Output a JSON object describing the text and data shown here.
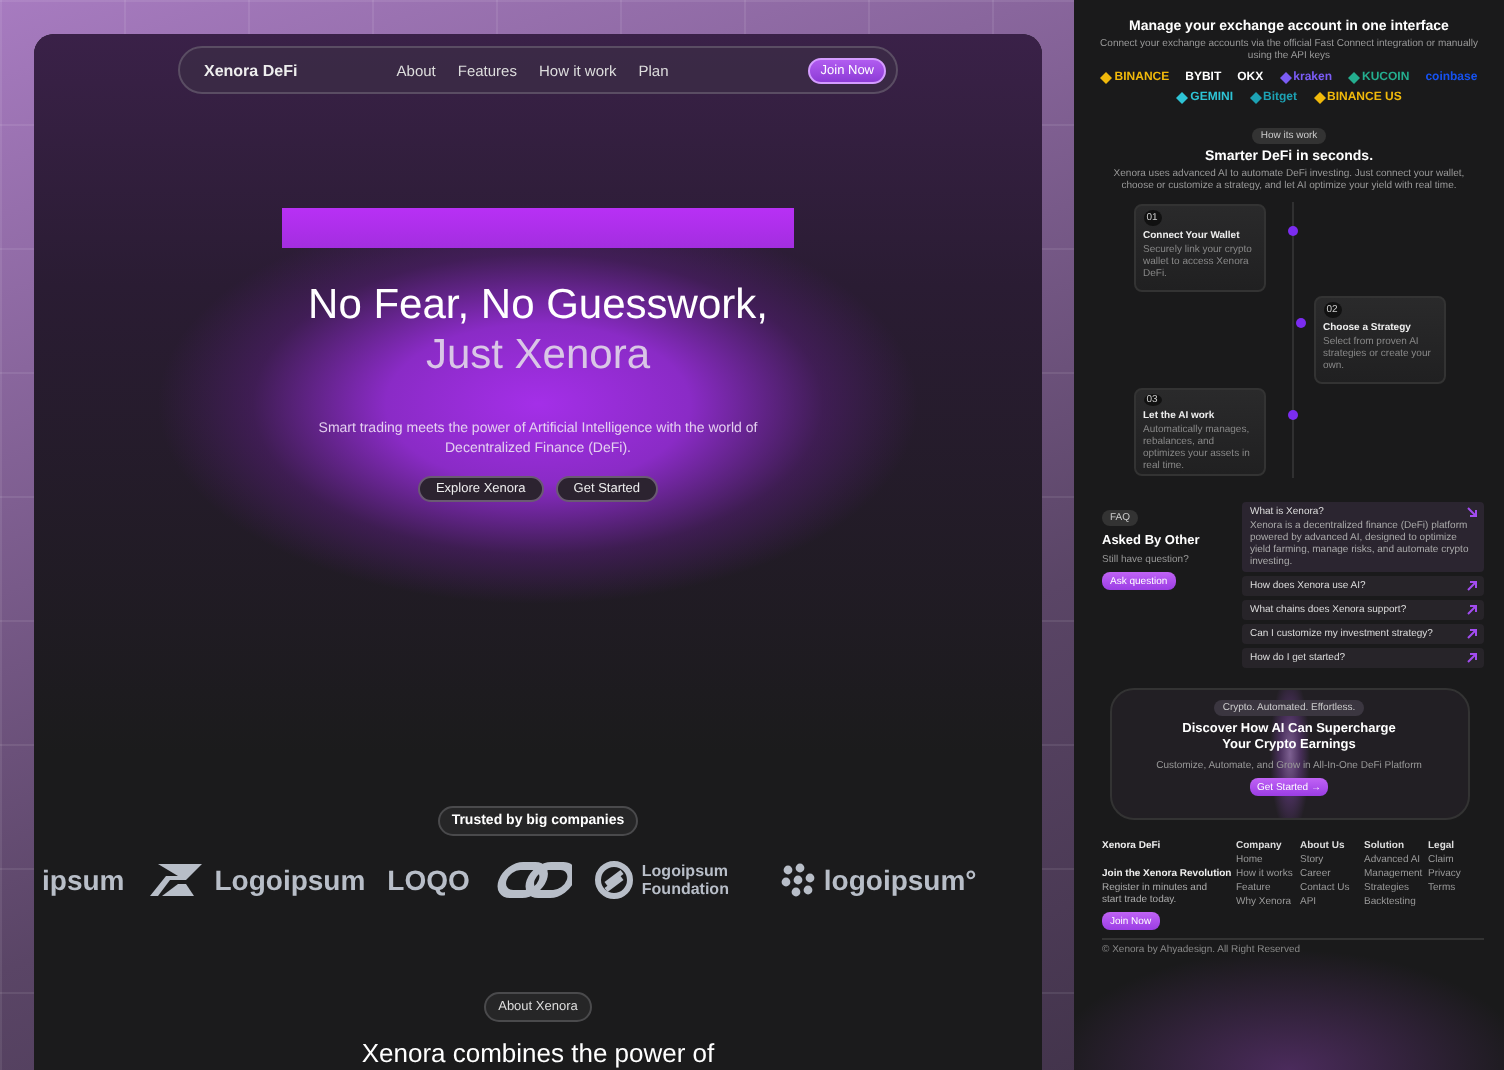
{
  "landing": {
    "nav": {
      "brand": "Xenora DeFi",
      "links": [
        "About",
        "Features",
        "How it work",
        "Plan"
      ],
      "cta": "Join Now"
    },
    "hero": {
      "title_line_1": "No Fear, No Guesswork,",
      "title_line_2": "Just Xenora",
      "subtitle": "Smart trading meets the power of Artificial Intelligence with the world of Decentralized Finance (DeFi).",
      "buttons": [
        "Explore Xenora",
        "Get Started"
      ]
    },
    "trusted": {
      "badge": "Trusted by big companies",
      "logos": [
        {
          "kind": "text",
          "text": "ipsum"
        },
        {
          "kind": "arrows",
          "text": "Logoipsum"
        },
        {
          "kind": "text",
          "text": "LOQO"
        },
        {
          "kind": "chain"
        },
        {
          "kind": "ring",
          "text": "Logoipsum Foundation"
        },
        {
          "kind": "dots",
          "text": "logoipsum°"
        }
      ]
    },
    "about": {
      "badge": "About Xenora",
      "heading": "Xenora combines the power of"
    }
  },
  "preview": {
    "exchanges": {
      "title": "Manage your exchange account in one interface",
      "subtitle": "Connect your exchange accounts via the official Fast Connect integration or manually using the API keys",
      "logos": [
        {
          "name": "BINANCE",
          "color": "#f0b90b",
          "icon": true
        },
        {
          "name": "BYBIT",
          "color": "#ffffff",
          "icon": false
        },
        {
          "name": "OKX",
          "color": "#ffffff",
          "icon": false
        },
        {
          "name": "kraken",
          "color": "#7b5cf5",
          "icon": true
        },
        {
          "name": "KUCOIN",
          "color": "#24ae8f",
          "icon": true
        },
        {
          "name": "coinbase",
          "color": "#1652f0",
          "icon": false
        },
        {
          "name": "GEMINI",
          "color": "#2ec4d6",
          "icon": true
        },
        {
          "name": "Bitget",
          "color": "#1da2b4",
          "icon": true
        },
        {
          "name": "BINANCE US",
          "color": "#f0b90b",
          "icon": true
        }
      ]
    },
    "steps": {
      "badge": "How its work",
      "title": "Smarter DeFi in seconds.",
      "subtitle": "Xenora uses advanced AI to automate DeFi investing. Just connect your wallet, choose or customize a strategy, and let AI optimize your yield with real time.",
      "items": [
        {
          "number": "01",
          "title": "Connect Your Wallet",
          "text": "Securely link your crypto wallet to access Xenora DeFi."
        },
        {
          "number": "02",
          "title": "Choose a Strategy",
          "text": "Select from proven AI strategies or create your own."
        },
        {
          "number": "03",
          "title": "Let the AI work",
          "text": "Automatically manages, rebalances, and optimizes your assets in real time."
        }
      ]
    },
    "faq": {
      "badge": "FAQ",
      "title": "Asked By Other",
      "subtitle": "Still have question?",
      "button": "Ask question",
      "items": [
        {
          "question": "What is Xenora?",
          "answer": "Xenora is a decentralized finance (DeFi) platform powered by advanced AI, designed to optimize yield farming, manage risks, and automate crypto investing.",
          "expanded": true
        },
        {
          "question": "How does Xenora use AI?",
          "expanded": false
        },
        {
          "question": "What chains does Xenora support?",
          "expanded": false
        },
        {
          "question": "Can I customize my investment strategy?",
          "expanded": false
        },
        {
          "question": "How do I get started?",
          "expanded": false
        }
      ]
    },
    "cta": {
      "badge": "Crypto. Automated. Effortless.",
      "title_line_1": "Discover How AI Can Supercharge",
      "title_line_2": "Your Crypto Earnings",
      "subtitle": "Customize, Automate, and Grow in All-In-One DeFi Platform",
      "button": "Get Started →"
    },
    "footer": {
      "brand": "Xenora DeFi",
      "join_title": "Join the Xenora Revolution",
      "join_text": "Register in minutes and start trade today.",
      "join_button": "Join Now",
      "columns": [
        {
          "heading": "Company",
          "links": [
            "Home",
            "How it works",
            "Feature",
            "Why Xenora"
          ]
        },
        {
          "heading": "About Us",
          "links": [
            "Story",
            "Career",
            "Contact Us",
            "API"
          ]
        },
        {
          "heading": "Solution",
          "links": [
            "Advanced AI",
            "Management",
            "Strategies",
            "Backtesting"
          ]
        },
        {
          "heading": "Legal",
          "links": [
            "Claim",
            "Privacy",
            "Terms"
          ]
        }
      ],
      "copyright": "© Xenora by Ahyadesign. All Right Reserved"
    }
  }
}
